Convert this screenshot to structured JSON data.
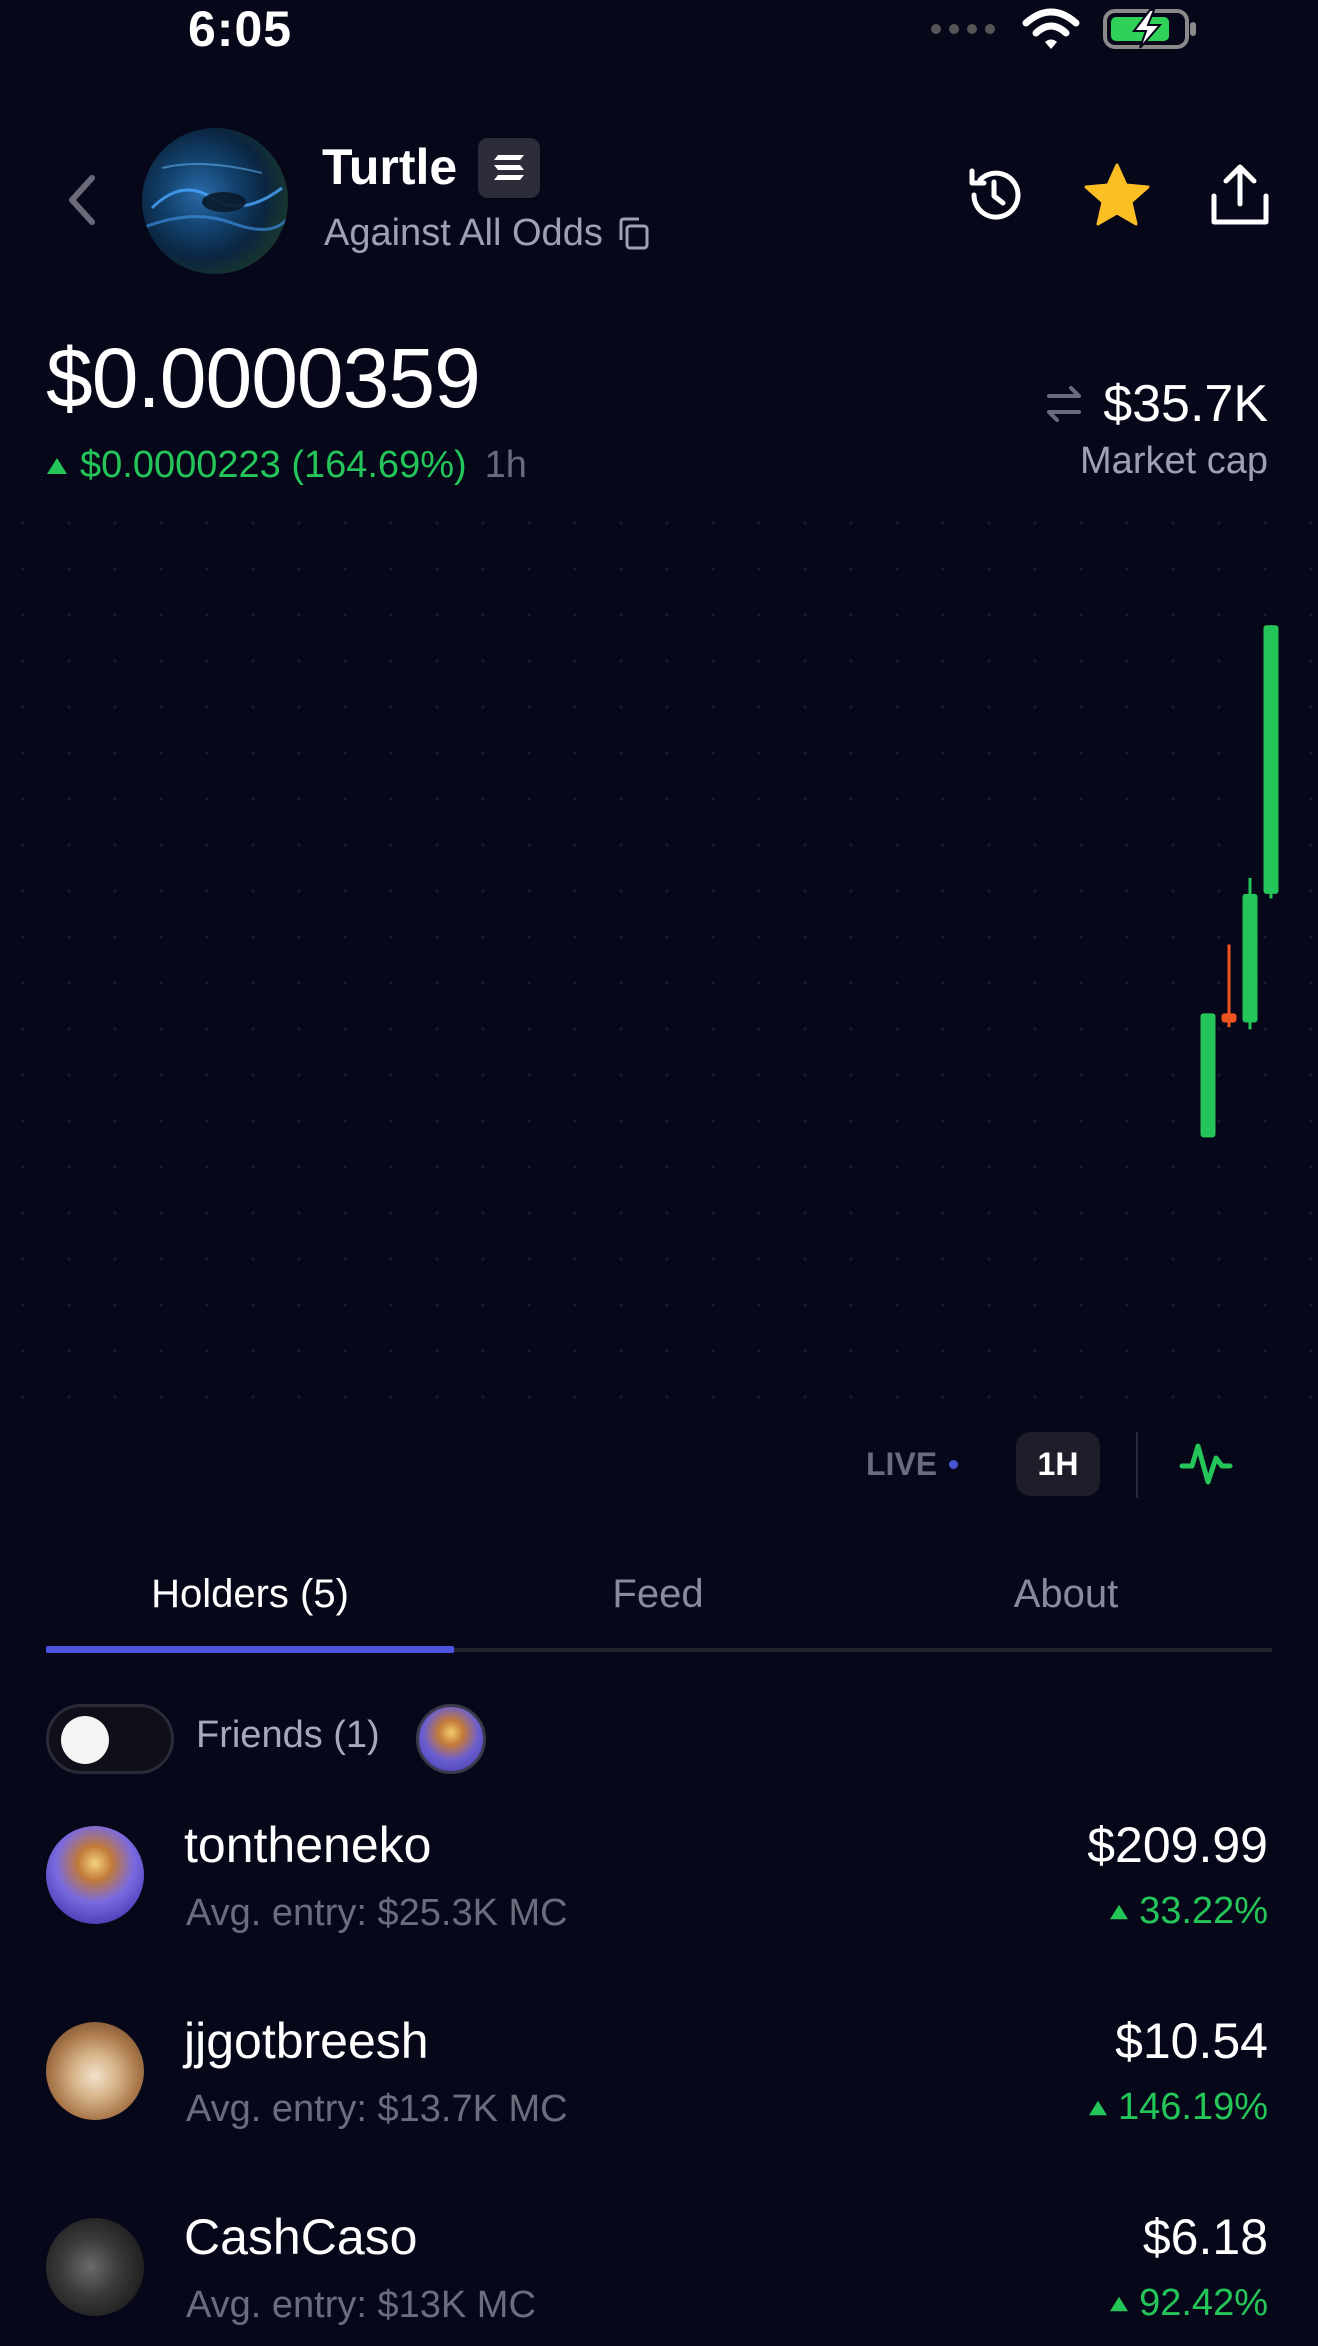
{
  "status_bar": {
    "time": "6:05"
  },
  "header": {
    "token_name": "Turtle",
    "token_subtitle": "Against All Odds",
    "icons": [
      "back-chevron-icon",
      "solana-icon",
      "copy-icon",
      "history-icon",
      "star-icon",
      "share-icon"
    ]
  },
  "price": {
    "current": "$0.0000359",
    "change": "$0.0000223 (164.69%)",
    "timeframe": "1h"
  },
  "market_cap": {
    "value": "$35.7K",
    "label": "Market cap"
  },
  "chart_controls": {
    "live_label": "LIVE",
    "timeframe": "1H"
  },
  "tabs": [
    {
      "label": "Holders (5)",
      "active": true
    },
    {
      "label": "Feed",
      "active": false
    },
    {
      "label": "About",
      "active": false
    }
  ],
  "friends": {
    "label": "Friends (1)",
    "toggle_on": false
  },
  "holders": [
    {
      "name": "tontheneko",
      "entry": "Avg. entry: $25.3K MC",
      "value": "$209.99",
      "pct": "33.22%"
    },
    {
      "name": "jjgotbreesh",
      "entry": "Avg. entry: $13.7K MC",
      "value": "$10.54",
      "pct": "146.19%"
    },
    {
      "name": "CashCaso",
      "entry": "Avg. entry: $13K MC",
      "value": "$6.18",
      "pct": "92.42%"
    }
  ],
  "colors": {
    "up": "#24c65a",
    "down": "#f0541e",
    "accent": "#4d55e0",
    "background": "#07071a"
  },
  "chart_data": {
    "type": "candlestick",
    "candles": [
      {
        "open": 1.36e-05,
        "high": 1.9e-05,
        "low": 1.36e-05,
        "close": 1.9e-05
      },
      {
        "open": 1.9e-05,
        "high": 2.2e-05,
        "low": 1.84e-05,
        "close": 1.86e-05
      },
      {
        "open": 1.86e-05,
        "high": 2.49e-05,
        "low": 1.83e-05,
        "close": 2.42e-05
      },
      {
        "open": 2.42e-05,
        "high": 3.59e-05,
        "low": 2.4e-05,
        "close": 3.59e-05
      }
    ],
    "ylim": [
      1e-05,
      3.7e-05
    ]
  }
}
